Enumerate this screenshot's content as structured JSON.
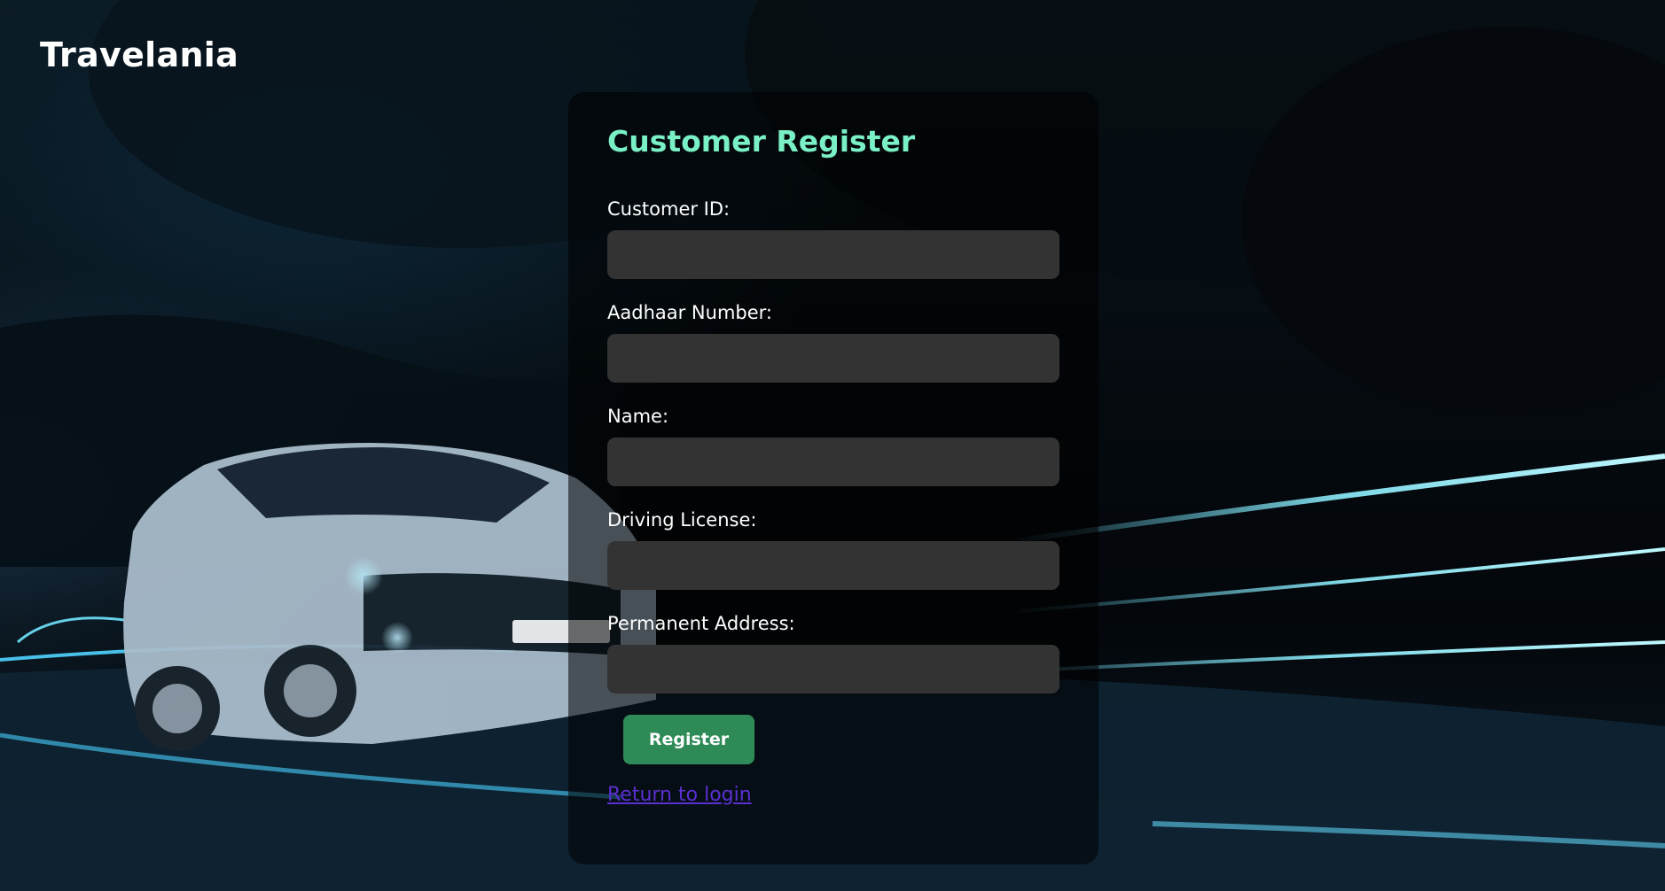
{
  "header": {
    "brand": "Travelania"
  },
  "form": {
    "title": "Customer Register",
    "fields": [
      {
        "label": "Customer ID:",
        "value": "",
        "placeholder": ""
      },
      {
        "label": "Aadhaar Number:",
        "value": "",
        "placeholder": ""
      },
      {
        "label": "Name:",
        "value": "",
        "placeholder": ""
      },
      {
        "label": "Driving License:",
        "value": "",
        "placeholder": ""
      },
      {
        "label": "Permanent Address:",
        "value": "",
        "placeholder": ""
      }
    ],
    "submit_label": "Register",
    "return_link": "Return to login"
  },
  "colors": {
    "title_accent": "#7af0c6",
    "button_bg": "#2e8b57",
    "input_bg": "#333333",
    "link": "#5a2fd1"
  }
}
